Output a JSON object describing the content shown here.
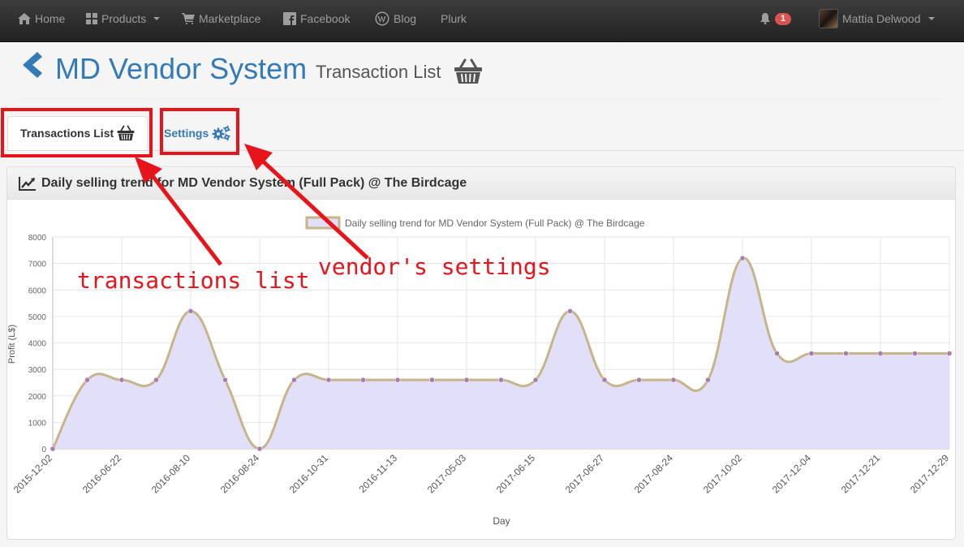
{
  "navbar": {
    "home": "Home",
    "products": "Products",
    "marketplace": "Marketplace",
    "facebook": "Facebook",
    "blog": "Blog",
    "plurk": "Plurk",
    "notification_count": "1",
    "user_name": "Mattia Delwood"
  },
  "header": {
    "title": "MD Vendor System",
    "subtitle": "Transaction List"
  },
  "tabs": {
    "transactions": "Transactions List",
    "settings": "Settings"
  },
  "panel": {
    "heading": "Daily selling trend for MD Vendor System (Full Pack) @ The Birdcage"
  },
  "annotations": {
    "transactions": "transactions list",
    "settings": "vendor's settings"
  },
  "colors": {
    "annotation_red": "#e8141b",
    "link_blue": "#337ab7",
    "series_line": "#c8b48a",
    "series_fill": "#e2dff8",
    "point": "#a87ab0"
  },
  "chart_data": {
    "type": "area",
    "title": "",
    "legend": "Daily selling trend for MD Vendor System (Full Pack) @ The Birdcage",
    "legend_position": "top",
    "xlabel": "Day",
    "ylabel": "Profit (L$)",
    "ylim": [
      0,
      8000
    ],
    "y_ticks": [
      "0",
      "1000",
      "2000",
      "3000",
      "4000",
      "5000",
      "6000",
      "7000",
      "8000"
    ],
    "grid": true,
    "x_tick_labels": [
      "2015-12-02",
      "2016-06-22",
      "2016-08-10",
      "2016-08-24",
      "2016-10-31",
      "2016-11-13",
      "2017-05-03",
      "2017-06-15",
      "2017-06-27",
      "2017-08-24",
      "2017-10-02",
      "2017-12-04",
      "2017-12-21",
      "2017-12-29"
    ],
    "series": [
      {
        "name": "Daily selling trend for MD Vendor System (Full Pack) @ The Birdcage",
        "values": [
          0,
          2600,
          2600,
          2600,
          5200,
          2600,
          0,
          2600,
          2600,
          2600,
          2600,
          2600,
          2600,
          2600,
          2600,
          5200,
          2600,
          2600,
          2600,
          2600,
          7200,
          3600,
          3600,
          3600,
          3600,
          3600,
          3600
        ]
      }
    ]
  }
}
